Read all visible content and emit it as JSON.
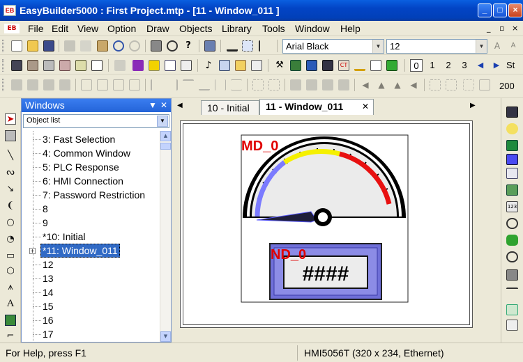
{
  "window": {
    "title": "EasyBuilder5000 : First Project.mtp - [11 - Window_011 ]",
    "app_icon": "EB",
    "controls": [
      "_",
      "□",
      "×"
    ]
  },
  "menubar": {
    "icon": "EB",
    "items": [
      "File",
      "Edit",
      "View",
      "Option",
      "Draw",
      "Objects",
      "Library",
      "Tools",
      "Window",
      "Help"
    ],
    "mdi_controls": [
      "_",
      "▫",
      "×"
    ]
  },
  "toolbar": {
    "font_name": "Arial Black",
    "font_size": "12",
    "pages": [
      "0",
      "1",
      "2",
      "3"
    ],
    "page_selected": "0",
    "st_label": "St",
    "zoom": "200"
  },
  "windows_panel": {
    "title": "Windows",
    "object_list": "Object list",
    "rows": [
      "3: Fast Selection",
      "4: Common Window",
      "5: PLC Response",
      "6: HMI Connection",
      "7: Password Restriction",
      "8",
      "9",
      "*10: Initial",
      "*11: Window_011",
      "12",
      "13",
      "14",
      "15",
      "16",
      "17"
    ],
    "selected_index": 8
  },
  "tabs": {
    "items": [
      "10 - Initial",
      "11 - Window_011"
    ],
    "active": 1
  },
  "canvas": {
    "meter_label": "MD_0",
    "numeric_label": "ND_0",
    "numeric_value": "####",
    "colors": {
      "label_red": "#e00000",
      "blue_band": "#7b7bff",
      "yellow_band": "#f5f000",
      "red_band": "#e81010",
      "needle": "#000000",
      "numeric_bg": "#6f6fd8"
    }
  },
  "statusbar": {
    "help": "For Help, press F1",
    "device": "HMI5056T (320 x 234, Ethernet)"
  }
}
